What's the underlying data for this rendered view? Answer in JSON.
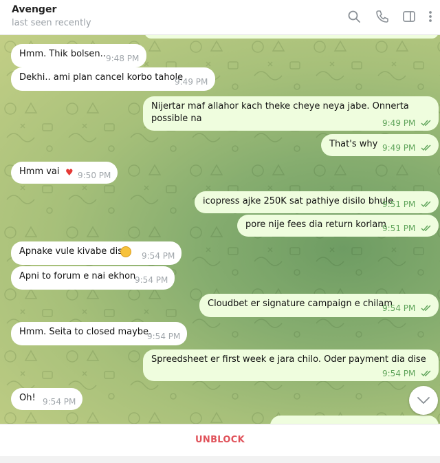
{
  "header": {
    "contact_name": "Avenger",
    "status": "last seen recently",
    "icons": [
      "search-icon",
      "phone-icon",
      "sidebar-toggle-icon",
      "more-vertical-icon"
    ]
  },
  "messages": [
    {
      "direction": "in",
      "text": "Hmm. Thik bolsen..",
      "time": "9:48 PM"
    },
    {
      "direction": "in",
      "text": "Dekhi.. ami plan cancel korbo tahole",
      "time": "9:49 PM"
    },
    {
      "direction": "out",
      "text": "Nijertar maf allahor kach theke cheye neya jabe. Onnerta possible na",
      "time": "9:49 PM",
      "read": true
    },
    {
      "direction": "out",
      "text": "That's why",
      "time": "9:49 PM",
      "read": true
    },
    {
      "direction": "in",
      "text": "Hmm vai",
      "emoji": "heart",
      "time": "9:50 PM"
    },
    {
      "direction": "out",
      "text": "icopress ajke 250K sat pathiye disilo bhule",
      "time": "9:51 PM",
      "read": true
    },
    {
      "direction": "out",
      "text": "pore nije fees dia return korlam",
      "time": "9:51 PM",
      "read": true
    },
    {
      "direction": "in",
      "text": "Apnake vule kivabe dise",
      "emoji": "thinking-face",
      "time": "9:54 PM"
    },
    {
      "direction": "in",
      "text": "Apni to forum e nai ekhon",
      "time": "9:54 PM"
    },
    {
      "direction": "out",
      "text": "Cloudbet er signature campaign e chilam",
      "time": "9:54 PM",
      "read": true
    },
    {
      "direction": "in",
      "text": "Hmm. Seita to closed maybe.",
      "time": "9:54 PM"
    },
    {
      "direction": "out",
      "text": "Spreedsheet er first week e jara chilo. Oder payment dia dise",
      "time": "9:54 PM",
      "read": true
    },
    {
      "direction": "in",
      "text": "Oh!",
      "time": "9:54 PM"
    }
  ],
  "colors": {
    "incoming_bubble": "#ffffff",
    "outgoing_bubble": "#effdde",
    "read_ticks": "#5fa45a",
    "unblock": "#e0525a"
  },
  "bottom_bar": {
    "unblock_label": "UNBLOCK"
  }
}
